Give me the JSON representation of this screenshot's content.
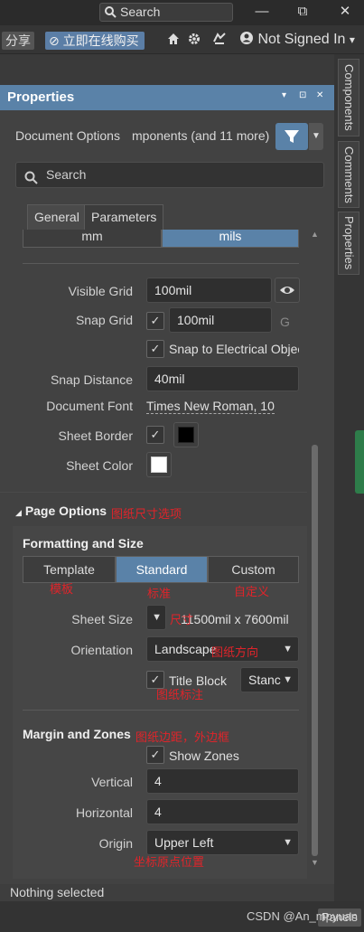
{
  "topbar": {
    "search_label": "Search",
    "minimize": "—",
    "restore": "⧉",
    "close": "✕"
  },
  "toolbar": {
    "share_label": "分享",
    "buy_label": "立即在线购买",
    "signin_label": "Not Signed In",
    "caret": "▾"
  },
  "side_tabs": [
    "Components",
    "Comments",
    "Properties"
  ],
  "panel": {
    "title": "Properties",
    "header_buttons": [
      "▾",
      "⊡",
      "✕"
    ],
    "document_options": "Document Options",
    "filter_summary": "mponents (and 11 more)",
    "search_placeholder": "Search",
    "tabs": [
      "General",
      "Parameters"
    ]
  },
  "units": {
    "mm": "mm",
    "mils": "mils",
    "selected": "mils"
  },
  "grid": {
    "visible_grid_label": "Visible Grid",
    "visible_grid_value": "100mil",
    "snap_grid_label": "Snap Grid",
    "snap_grid_value": "100mil",
    "snap_grid_suffix": "G",
    "snap_electrical_label": "Snap to Electrical Object",
    "snap_distance_label": "Snap Distance",
    "snap_distance_value": "40mil",
    "document_font_label": "Document Font",
    "document_font_value": "Times New Roman, 10",
    "sheet_border_label": "Sheet Border",
    "sheet_color_label": "Sheet Color"
  },
  "page_options": {
    "title": "Page Options",
    "title_note": "图纸尺寸选项",
    "formatting_title": "Formatting and Size",
    "modes": [
      "Template",
      "Standard",
      "Custom"
    ],
    "mode_notes": [
      "模板",
      "标准",
      "自定义"
    ],
    "selected_mode": "Standard",
    "sheet_size_label": "Sheet Size",
    "sheet_size_note": "尺寸",
    "sheet_size_value": "11500mil  x  7600mil",
    "orientation_label": "Orientation",
    "orientation_value": "Landscape",
    "orientation_note": "图纸方向",
    "title_block_label": "Title Block",
    "title_block_value": "Stanc",
    "title_block_note": "图纸标注"
  },
  "margin": {
    "title": "Margin and Zones",
    "title_note": "图纸边距，外边框",
    "show_zones_label": "Show Zones",
    "vertical_label": "Vertical",
    "vertical_value": "4",
    "horizontal_label": "Horizontal",
    "horizontal_value": "4",
    "origin_label": "Origin",
    "origin_value": "Upper Left",
    "origin_note": "坐标原点位置"
  },
  "status": {
    "text": "Nothing selected"
  },
  "bottom": {
    "panels_label": "Panels",
    "watermark": "CSDN @An_mpyuan"
  },
  "colors": {
    "accent": "#5a82a8",
    "annotation": "#e0242a",
    "sheet_border": "#000000",
    "sheet_color": "#ffffff"
  }
}
